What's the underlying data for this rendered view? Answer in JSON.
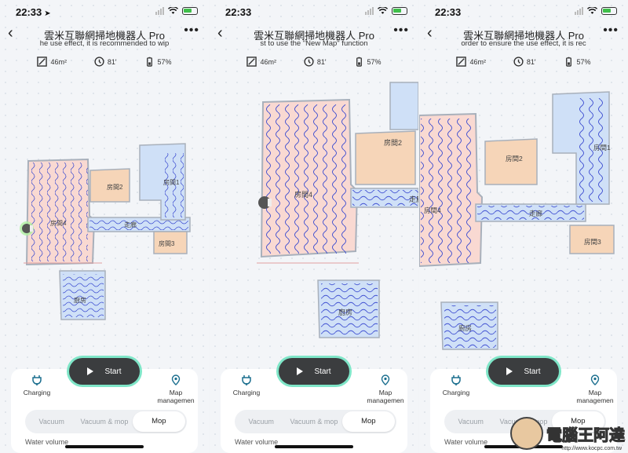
{
  "panels": [
    {
      "status": {
        "time": "22:33",
        "location_arrow": true
      },
      "title": "雲米互聯網掃地機器人 Pro",
      "notice": "he use effect, it is recommended to wip",
      "stats": {
        "area": "46m²",
        "time": "81'",
        "battery": "57%"
      },
      "rooms": {
        "r1": "房間1",
        "r2": "房間2",
        "r3": "房間3",
        "r4": "房間4",
        "corridor": "走廊",
        "kitchen": "廚房"
      },
      "start_label": "Start",
      "charging_label": "Charging",
      "map_label": "Map managemen",
      "modes": [
        "Vacuum",
        "Vacuum & mop",
        "Mop"
      ],
      "active_mode": "Mop",
      "water_label": "Water volume"
    },
    {
      "status": {
        "time": "22:33",
        "location_arrow": false
      },
      "title": "雲米互聯網掃地機器人 Pro",
      "notice": "st to use the \"New Map\" function",
      "stats": {
        "area": "46m²",
        "time": "81'",
        "battery": "57%"
      },
      "rooms": {
        "r2": "房間2",
        "r4": "房間4",
        "corridor": "走廊",
        "kitchen": "廚房"
      },
      "start_label": "Start",
      "charging_label": "Charging",
      "map_label": "Map managemen",
      "modes": [
        "Vacuum",
        "Vacuum & mop",
        "Mop"
      ],
      "active_mode": "Mop",
      "water_label": "Water volume"
    },
    {
      "status": {
        "time": "22:33",
        "location_arrow": false
      },
      "title": "雲米互聯網掃地機器人 Pro",
      "notice": "order to ensure the use effect, it is rec",
      "stats": {
        "area": "46m²",
        "time": "81'",
        "battery": "57%"
      },
      "rooms": {
        "r1": "房間1",
        "r2": "房間2",
        "r3": "房間3",
        "r4": "房間4",
        "corridor": "走廊",
        "kitchen": "廚房"
      },
      "start_label": "Start",
      "charging_label": "Charging",
      "map_label": "Map managemen",
      "modes": [
        "Vacuum",
        "Vacuum & mop",
        "Mop"
      ],
      "active_mode": "Mop",
      "water_label": "Water volume"
    }
  ],
  "watermark": {
    "text": "電腦王阿達",
    "url": "http://www.kocpc.com.tw"
  },
  "colors": {
    "room_pink": "#f9d9d2",
    "room_blue": "#cfe0f7",
    "room_orange": "#f6d5b8",
    "mop_line": "#3b4bd0",
    "start_glow": "#7fe6c8"
  }
}
